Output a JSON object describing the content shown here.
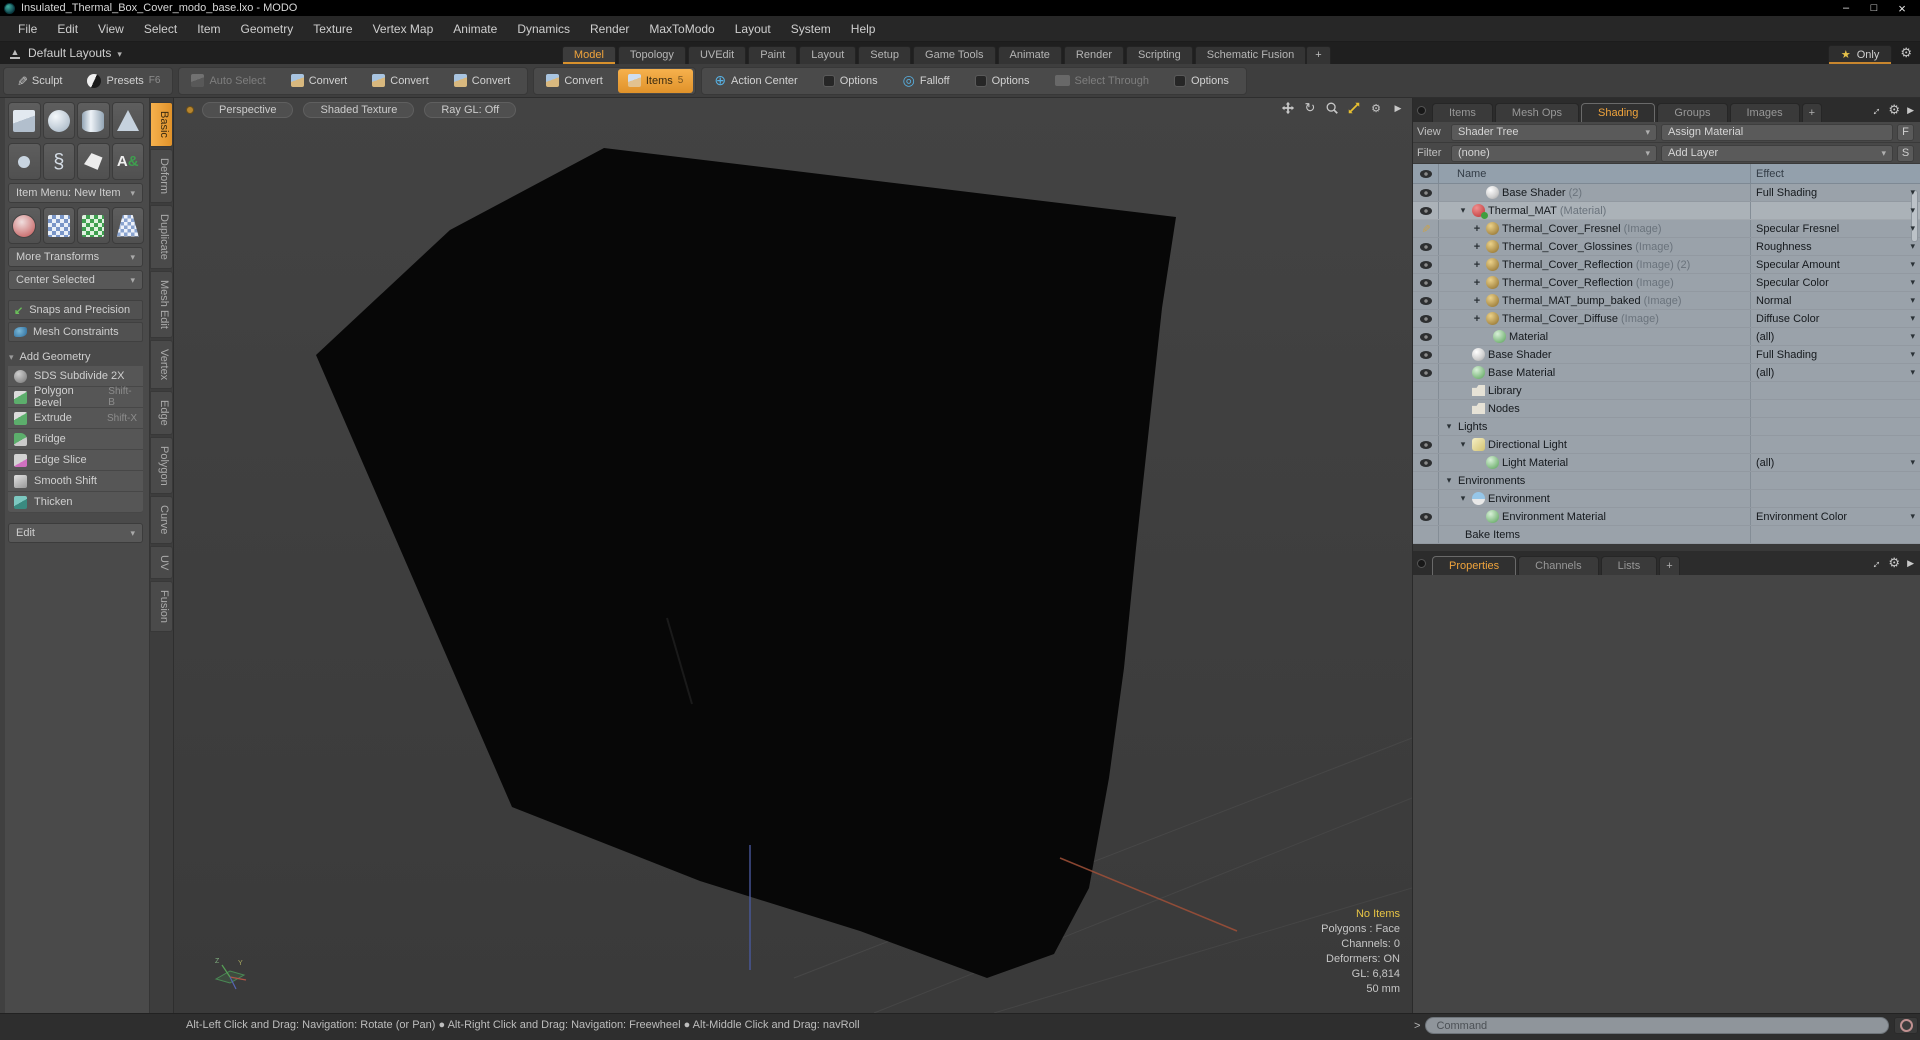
{
  "window": {
    "title": "Insulated_Thermal_Box_Cover_modo_base.lxo - MODO",
    "minimize": "–",
    "maximize": "□",
    "close": "×"
  },
  "menu_bar": [
    "File",
    "Edit",
    "View",
    "Select",
    "Item",
    "Geometry",
    "Texture",
    "Vertex Map",
    "Animate",
    "Dynamics",
    "Render",
    "MaxToModo",
    "Layout",
    "System",
    "Help"
  ],
  "layout_bar": {
    "layout_selector": "Default Layouts",
    "tabs": [
      {
        "label": "Model",
        "active": true
      },
      {
        "label": "Topology"
      },
      {
        "label": "UVEdit"
      },
      {
        "label": "Paint"
      },
      {
        "label": "Layout"
      },
      {
        "label": "Setup"
      },
      {
        "label": "Game Tools"
      },
      {
        "label": "Animate"
      },
      {
        "label": "Render"
      },
      {
        "label": "Scripting"
      },
      {
        "label": "Schematic Fusion"
      }
    ],
    "add_tab": "+",
    "only_label": "Only"
  },
  "toolbar": {
    "groups": [
      {
        "buttons": [
          {
            "label": "Sculpt",
            "icon": "brush"
          },
          {
            "label": "Presets",
            "shortcut": "F6",
            "icon": "preset"
          }
        ]
      },
      {
        "buttons": [
          {
            "label": "Auto Select",
            "icon": "cube-gray",
            "disabled": true
          },
          {
            "label": "Convert",
            "icon": "cube-conv"
          },
          {
            "label": "Convert",
            "icon": "cube-conv"
          },
          {
            "label": "Convert",
            "icon": "cube-conv"
          }
        ]
      },
      {
        "buttons": [
          {
            "label": "Convert",
            "icon": "cube-conv"
          },
          {
            "label": "Items",
            "shortcut": "5",
            "icon": "cube-items",
            "active": true
          }
        ]
      },
      {
        "buttons": [
          {
            "label": "Action Center",
            "icon": "action"
          },
          {
            "label": "Options",
            "icon": "options"
          },
          {
            "label": "Falloff",
            "icon": "falloff"
          },
          {
            "label": "Options",
            "icon": "options"
          },
          {
            "label": "Select Through",
            "icon": "through",
            "disabled": true
          },
          {
            "label": "Options",
            "icon": "options"
          }
        ]
      }
    ]
  },
  "sidebar": {
    "primitive_row1": [
      "cube",
      "sphere",
      "cylinder",
      "cone"
    ],
    "primitive_row2": [
      "torus",
      "coil",
      "bezier",
      "text"
    ],
    "item_menu_label": "Item Menu: New Item",
    "tool_row": [
      "gizmo",
      "lattice",
      "checker-cube",
      "checker-plane"
    ],
    "more_transforms": "More Transforms",
    "center_selected": "Center Selected",
    "snaps": "Snaps and Precision",
    "mesh_constraints": "Mesh Constraints",
    "add_geometry_header": "Add Geometry",
    "tools": [
      {
        "label": "SDS Subdivide 2X",
        "icon": "sds"
      },
      {
        "label": "Polygon Bevel",
        "shortcut": "Shift-B",
        "icon": "bevel"
      },
      {
        "label": "Extrude",
        "shortcut": "Shift-X",
        "icon": "extrude"
      },
      {
        "label": "Bridge",
        "icon": "bridge"
      },
      {
        "label": "Edge Slice",
        "icon": "slice"
      },
      {
        "label": "Smooth Shift",
        "icon": "smooth"
      },
      {
        "label": "Thicken",
        "icon": "thicken"
      }
    ],
    "edit_label": "Edit"
  },
  "tool_tabs": [
    {
      "label": "Basic",
      "active": true
    },
    {
      "label": "Deform"
    },
    {
      "label": "Duplicate"
    },
    {
      "label": "Mesh Edit"
    },
    {
      "label": "Vertex"
    },
    {
      "label": "Edge"
    },
    {
      "label": "Polygon"
    },
    {
      "label": "Curve"
    },
    {
      "label": "UV"
    },
    {
      "label": "Fusion"
    }
  ],
  "viewport": {
    "modes": [
      {
        "label": "Perspective"
      },
      {
        "label": "Shaded Texture"
      },
      {
        "label": "Ray GL: Off"
      }
    ],
    "stats": {
      "highlight": "No Items",
      "lines": [
        "Polygons : Face",
        "Channels: 0",
        "Deformers: ON",
        "GL: 6,814",
        "50 mm"
      ]
    }
  },
  "right_panel": {
    "tabs": [
      {
        "label": "Items"
      },
      {
        "label": "Mesh Ops"
      },
      {
        "label": "Shading",
        "active": true
      },
      {
        "label": "Groups"
      },
      {
        "label": "Images"
      }
    ],
    "add_tab": "+",
    "view_label": "View",
    "view_value": "Shader Tree",
    "assign_material_label": "Assign Material",
    "f_button": "F",
    "filter_label": "Filter",
    "filter_value": "(none)",
    "add_layer_label": "Add Layer",
    "s_button": "S",
    "name_column": "Name",
    "effect_column": "Effect",
    "tree": [
      {
        "vis": "eye",
        "tw": "",
        "indent": 2,
        "icon": "sphere-white",
        "name": "Base Shader",
        "dim": "(2)",
        "effect": "Full Shading",
        "dd": true
      },
      {
        "vis": "eye",
        "tw": "open",
        "indent": 1,
        "icon": "mat-red",
        "name": "Thermal_MAT",
        "dim": "(Material)",
        "effect": "",
        "dd": true,
        "selected": true
      },
      {
        "vis": "brush",
        "tw": "plus",
        "indent": 2,
        "icon": "img-gold",
        "name": "Thermal_Cover_Fresnel",
        "dim": "(Image)",
        "effect": "Specular Fresnel",
        "dd": true
      },
      {
        "vis": "eye",
        "tw": "plus",
        "indent": 2,
        "icon": "img-gold",
        "name": "Thermal_Cover_Glossines",
        "dim": "(Image)",
        "effect": "Roughness",
        "dd": true
      },
      {
        "vis": "eye",
        "tw": "plus",
        "indent": 2,
        "icon": "img-gold",
        "name": "Thermal_Cover_Reflection",
        "dim": "(Image) (2)",
        "effect": "Specular Amount",
        "dd": true
      },
      {
        "vis": "eye",
        "tw": "plus",
        "indent": 2,
        "icon": "img-gold",
        "name": "Thermal_Cover_Reflection",
        "dim": "(Image)",
        "effect": "Specular Color",
        "dd": true
      },
      {
        "vis": "eye",
        "tw": "plus",
        "indent": 2,
        "icon": "img-gold",
        "name": "Thermal_MAT_bump_baked",
        "dim": "(Image)",
        "effect": "Normal",
        "dd": true
      },
      {
        "vis": "eye",
        "tw": "plus",
        "indent": 2,
        "icon": "img-gold",
        "name": "Thermal_Cover_Diffuse",
        "dim": "(Image)",
        "effect": "Diffuse Color",
        "dd": true
      },
      {
        "vis": "eye",
        "tw": "",
        "indent": 2.5,
        "icon": "sphere-green",
        "name": "Material",
        "dim": "",
        "effect": "(all)",
        "dd": true
      },
      {
        "vis": "eye",
        "tw": "",
        "indent": 1,
        "icon": "sphere-white",
        "name": "Base Shader",
        "dim": "",
        "effect": "Full Shading",
        "dd": true
      },
      {
        "vis": "eye",
        "tw": "",
        "indent": 1,
        "icon": "sphere-green",
        "name": "Base Material",
        "dim": "",
        "effect": "(all)",
        "dd": true
      },
      {
        "vis": "",
        "tw": "",
        "indent": 1,
        "icon": "folder",
        "name": "Library",
        "dim": "",
        "effect": "",
        "dd": false
      },
      {
        "vis": "",
        "tw": "",
        "indent": 1,
        "icon": "folder",
        "name": "Nodes",
        "dim": "",
        "effect": "",
        "dd": false
      },
      {
        "vis": "",
        "tw": "open",
        "indent": 0,
        "icon": "",
        "name": "Lights",
        "dim": "",
        "effect": "",
        "dd": false
      },
      {
        "vis": "eye",
        "tw": "open",
        "indent": 1,
        "icon": "light",
        "name": "Directional Light",
        "dim": "",
        "effect": "",
        "dd": false
      },
      {
        "vis": "eye",
        "tw": "",
        "indent": 2,
        "icon": "sphere-green",
        "name": "Light Material",
        "dim": "",
        "effect": "(all)",
        "dd": true
      },
      {
        "vis": "",
        "tw": "open",
        "indent": 0,
        "icon": "",
        "name": "Environments",
        "dim": "",
        "effect": "",
        "dd": false
      },
      {
        "vis": "",
        "tw": "open",
        "indent": 1,
        "icon": "env",
        "name": "Environment",
        "dim": "",
        "effect": "",
        "dd": false
      },
      {
        "vis": "eye",
        "tw": "",
        "indent": 2,
        "icon": "sphere-green",
        "name": "Environment Material",
        "dim": "",
        "effect": "Environment Color",
        "dd": true
      },
      {
        "vis": "",
        "tw": "",
        "indent": 0.5,
        "icon": "",
        "name": "Bake Items",
        "dim": "",
        "effect": "",
        "dd": false
      }
    ],
    "bottom_tabs": [
      {
        "label": "Properties",
        "active": true
      },
      {
        "label": "Channels"
      },
      {
        "label": "Lists"
      }
    ],
    "bottom_add_tab": "+"
  },
  "bottom_bar": {
    "help_text": "Alt-Left Click and Drag: Navigation: Rotate (or Pan)  ●  Alt-Right Click and Drag: Navigation: Freewheel  ●  Alt-Middle Click and Drag: navRoll",
    "command_prompt": ">",
    "command_placeholder": "Command"
  },
  "colors": {
    "accent_orange": "#f0a43c",
    "tree_background": "#9aa2aa",
    "highlight_yellow": "#e8c545",
    "viewport_background": "#3d3d3d"
  }
}
